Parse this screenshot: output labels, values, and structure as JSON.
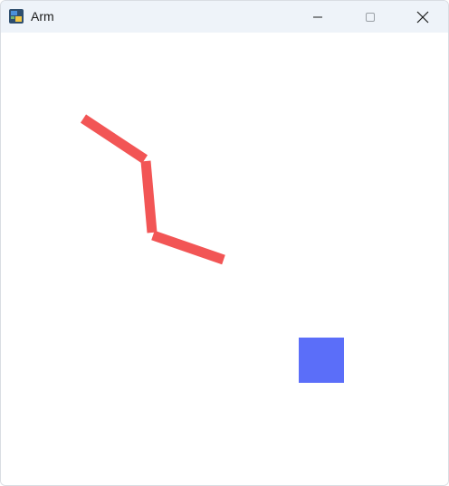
{
  "window": {
    "title": "Arm",
    "app_icon": "python-icon",
    "controls": {
      "minimize_icon": "minimize-icon",
      "maximize_icon": "maximize-icon",
      "close_icon": "close-icon"
    }
  },
  "scene": {
    "arm_color": "#f25555",
    "target_color": "#5b6ef9",
    "background_color": "#ffffff"
  }
}
